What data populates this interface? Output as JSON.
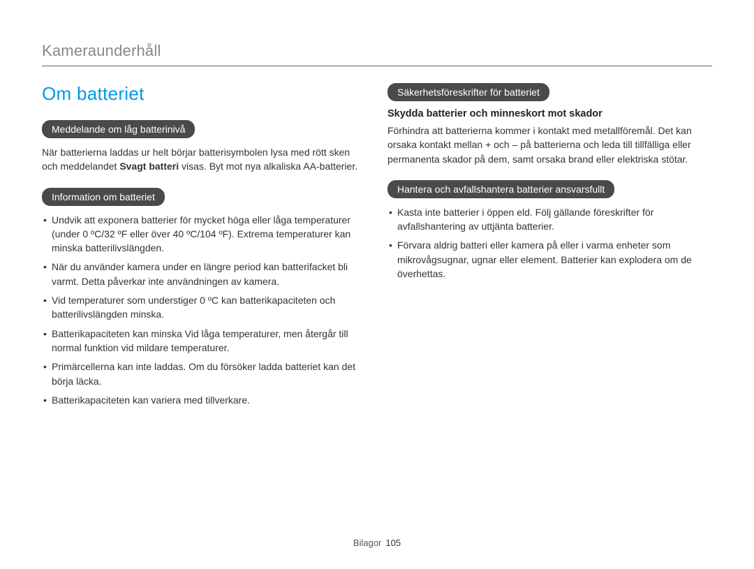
{
  "chapter_title": "Kameraunderhåll",
  "section_title": "Om batteriet",
  "left_column": {
    "pill1": "Meddelande om låg batterinivå",
    "para1_pre": "När batterierna laddas ur helt börjar batterisymbolen lysa med rött sken och meddelandet ",
    "para1_bold": "Svagt batteri",
    "para1_post": " visas. Byt mot nya alkaliska AA-batterier.",
    "pill2": "Information om batteriet",
    "bullets": [
      "Undvik att exponera batterier för mycket höga eller låga temperaturer (under 0 ºC/32 ºF eller över 40 ºC/104 ºF). Extrema temperaturer kan minska batterilivslängden.",
      "När du använder kamera under en längre period kan batterifacket bli varmt. Detta påverkar inte användningen av kamera.",
      "Vid temperaturer som understiger 0 ºC kan batterikapaciteten och batterilivslängden minska.",
      "Batterikapaciteten kan minska Vid låga temperaturer, men återgår till normal funktion vid mildare temperaturer.",
      "Primärcellerna kan inte laddas. Om du försöker ladda batteriet kan det börja läcka.",
      "Batterikapaciteten kan variera med tillverkare."
    ]
  },
  "right_column": {
    "pill1": "Säkerhetsföreskrifter för batteriet",
    "subhead1": "Skydda batterier och minneskort mot skador",
    "para1": "Förhindra att batterierna kommer i kontakt med metallföremål. Det kan orsaka kontakt mellan + och – på batterierna och leda till tillfälliga eller permanenta skador på dem, samt orsaka brand eller elektriska stötar.",
    "pill2": "Hantera och avfallshantera batterier ansvarsfullt",
    "bullets": [
      "Kasta inte batterier i öppen eld. Följ gällande föreskrifter för avfallshantering av uttjänta batterier.",
      "Förvara aldrig batteri eller kamera på eller i varma enheter som mikrovågsugnar, ugnar eller element. Batterier kan explodera om de överhettas."
    ]
  },
  "footer": {
    "label": "Bilagor",
    "page": "105"
  }
}
